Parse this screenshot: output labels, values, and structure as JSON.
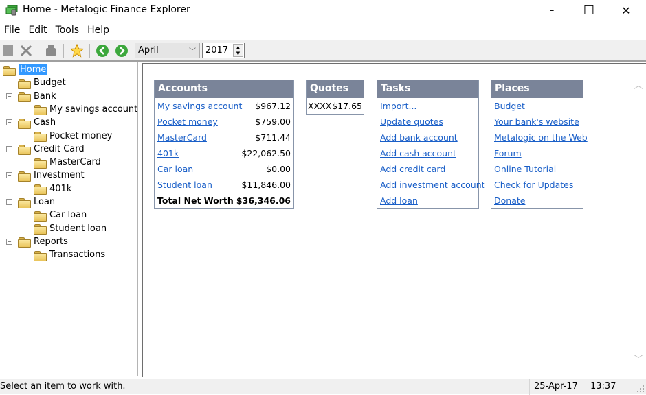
{
  "window": {
    "title": "Home - Metalogic Finance Explorer",
    "controls": {
      "minimize": "–",
      "maximize": "☐",
      "close": "✕"
    }
  },
  "menu": [
    "File",
    "Edit",
    "Tools",
    "Help"
  ],
  "toolbar": {
    "buttons": [
      "new-icon",
      "delete-icon",
      "print-icon",
      "favorite-star-icon",
      "back-arrow-icon",
      "forward-arrow-icon"
    ],
    "month": "April",
    "year": "2017"
  },
  "tree": [
    {
      "label": "Home",
      "level": 0,
      "selected": true
    },
    {
      "label": "Budget",
      "level": 1
    },
    {
      "label": "Bank",
      "level": 1,
      "expanded": true
    },
    {
      "label": "My savings account",
      "level": 2
    },
    {
      "label": "Cash",
      "level": 1,
      "expanded": true
    },
    {
      "label": "Pocket money",
      "level": 2
    },
    {
      "label": "Credit Card",
      "level": 1,
      "expanded": true
    },
    {
      "label": "MasterCard",
      "level": 2
    },
    {
      "label": "Investment",
      "level": 1,
      "expanded": true
    },
    {
      "label": "401k",
      "level": 2
    },
    {
      "label": "Loan",
      "level": 1,
      "expanded": true
    },
    {
      "label": "Car loan",
      "level": 2
    },
    {
      "label": "Student loan",
      "level": 2
    },
    {
      "label": "Reports",
      "level": 1,
      "expanded": true
    },
    {
      "label": "Transactions",
      "level": 2
    }
  ],
  "accounts": {
    "title": "Accounts",
    "rows": [
      {
        "name": "My savings account",
        "amount": "$967.12"
      },
      {
        "name": "Pocket money",
        "amount": "$759.00"
      },
      {
        "name": "MasterCard",
        "amount": "$711.44"
      },
      {
        "name": "401k",
        "amount": "$22,062.50"
      },
      {
        "name": "Car loan",
        "amount": "$0.00"
      },
      {
        "name": "Student loan",
        "amount": "$11,846.00"
      }
    ],
    "total_label": "Total Net Worth",
    "total": "$36,346.06"
  },
  "quotes": {
    "title": "Quotes",
    "rows": [
      {
        "symbol": "XXXX",
        "price": "$17.65"
      }
    ]
  },
  "tasks": {
    "title": "Tasks",
    "items": [
      "Import...",
      "Update quotes",
      "Add bank account",
      "Add cash account",
      "Add credit card",
      "Add investment account",
      "Add loan"
    ]
  },
  "places": {
    "title": "Places",
    "items": [
      "Budget",
      "Your bank's website",
      "Metalogic on the Web",
      "Forum",
      "Online Tutorial",
      "Check for Updates",
      "Donate"
    ]
  },
  "status": {
    "message": "Select an item to work with.",
    "date": "25-Apr-17",
    "time": "13:37"
  }
}
